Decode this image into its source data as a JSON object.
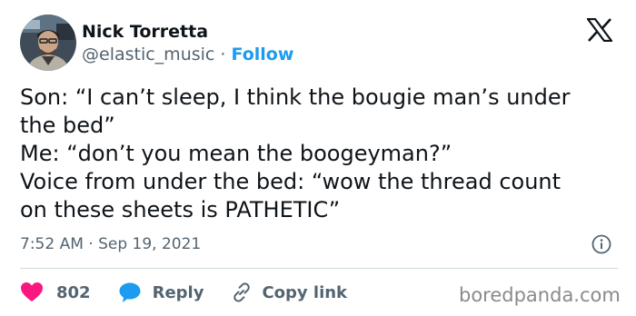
{
  "author": {
    "display_name": "Nick Torretta",
    "handle": "@elastic_music",
    "separator": "·",
    "follow_label": "Follow",
    "avatar_icon": "profile-photo"
  },
  "platform_icon": "x-logo-icon",
  "tweet": {
    "lines": [
      "Son: “I can’t sleep, I think the bougie man’s under",
      "the bed”",
      "Me: “don’t you mean the boogeyman?”",
      "Voice from under the bed: “wow the thread count",
      "on these sheets is PATHETIC”"
    ]
  },
  "meta": {
    "timestamp": "7:52 AM · Sep 19, 2021",
    "info_icon": "info-icon"
  },
  "actions": {
    "like_count": "802",
    "reply_label": "Reply",
    "copy_link_label": "Copy link"
  },
  "watermark": "boredpanda.com",
  "colors": {
    "text": "#0f1419",
    "secondary": "#536471",
    "accent": "#1d9bf0",
    "like": "#f91880",
    "divider": "#cfd9de"
  }
}
